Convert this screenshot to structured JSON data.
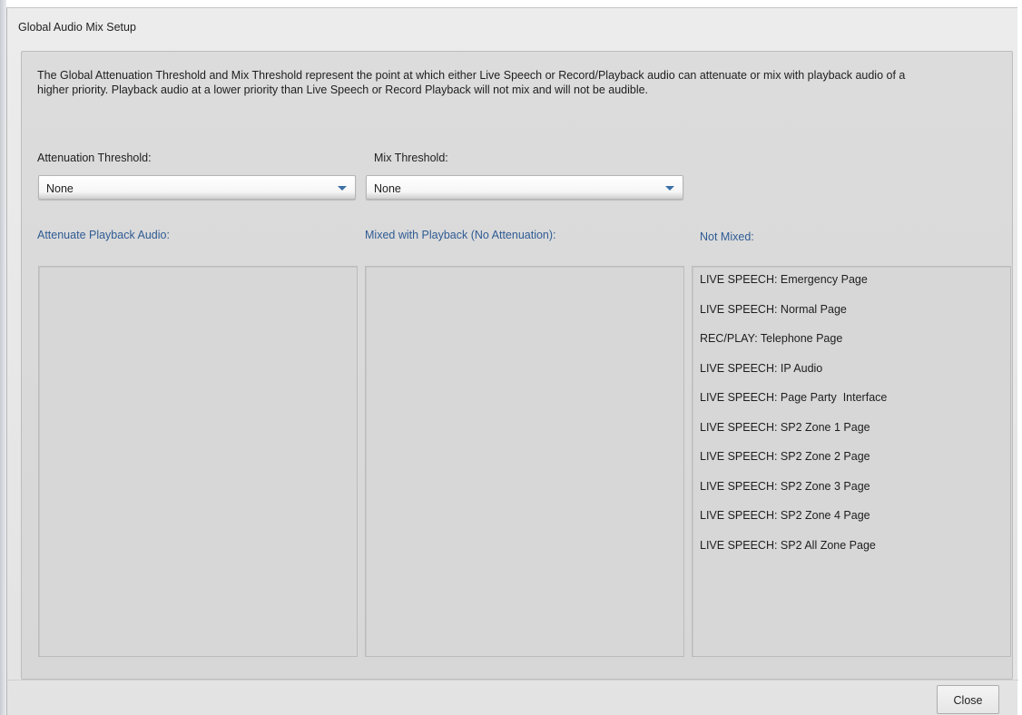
{
  "dialog": {
    "title": "Global Audio Mix Setup",
    "description": "The Global Attenuation Threshold and Mix Threshold represent the point at which either Live Speech or Record/Playback audio can attenuate or mix with playback audio of a higher priority. Playback audio at a lower priority than Live Speech or Record Playback will not mix and will not be audible."
  },
  "attenuation": {
    "label": "Attenuation Threshold:",
    "selected": "None"
  },
  "mix": {
    "label": "Mix Threshold:",
    "selected": "None"
  },
  "columns": {
    "attenuate_header": "Attenuate Playback Audio:",
    "mixed_header": "Mixed with Playback (No Attenuation):",
    "not_mixed_header": "Not Mixed:",
    "attenuate_items": [],
    "mixed_items": [],
    "not_mixed_items": [
      "LIVE SPEECH: Emergency Page",
      "LIVE SPEECH: Normal Page",
      "REC/PLAY: Telephone Page",
      "LIVE SPEECH: IP Audio",
      "LIVE SPEECH: Page Party  Interface",
      "LIVE SPEECH: SP2 Zone 1 Page",
      "LIVE SPEECH: SP2 Zone 2 Page",
      "LIVE SPEECH: SP2 Zone 3 Page",
      "LIVE SPEECH: SP2 Zone 4 Page",
      "LIVE SPEECH: SP2 All Zone Page"
    ]
  },
  "footer": {
    "close_label": "Close"
  },
  "colors": {
    "header_blue": "#2f5b93",
    "caret_blue": "#3a6ea5"
  },
  "icons": {
    "dropdown_caret": "chevron-down-icon"
  }
}
